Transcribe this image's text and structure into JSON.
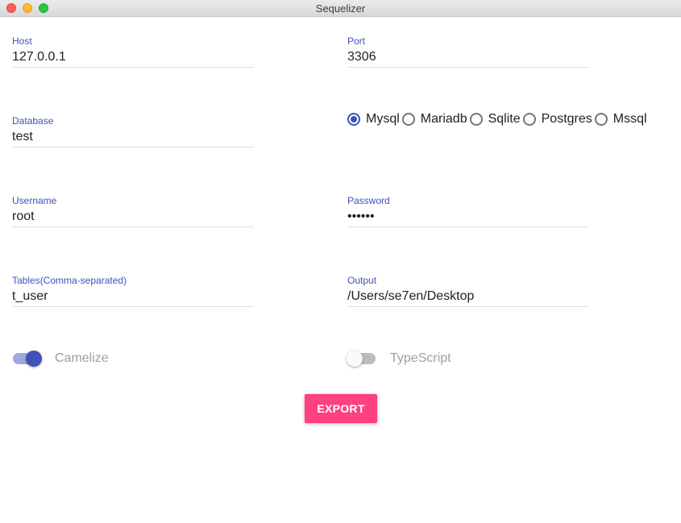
{
  "window": {
    "title": "Sequelizer"
  },
  "form": {
    "host": {
      "label": "Host",
      "value": "127.0.0.1"
    },
    "port": {
      "label": "Port",
      "value": "3306"
    },
    "database": {
      "label": "Database",
      "value": "test"
    },
    "username": {
      "label": "Username",
      "value": "root"
    },
    "password": {
      "label": "Password",
      "value": "••••••"
    },
    "tables": {
      "label": "Tables(Comma-separated)",
      "value": "t_user"
    },
    "output": {
      "label": "Output",
      "value": "/Users/se7en/Desktop"
    }
  },
  "dialects": {
    "selected": "Mysql",
    "options": [
      "Mysql",
      "Mariadb",
      "Sqlite",
      "Postgres",
      "Mssql"
    ]
  },
  "toggles": {
    "camelize": {
      "label": "Camelize",
      "on": true
    },
    "typescript": {
      "label": "TypeScript",
      "on": false
    }
  },
  "actions": {
    "export_label": "EXPORT"
  },
  "colors": {
    "primary": "#3f51b5",
    "accent": "#ff4081"
  }
}
